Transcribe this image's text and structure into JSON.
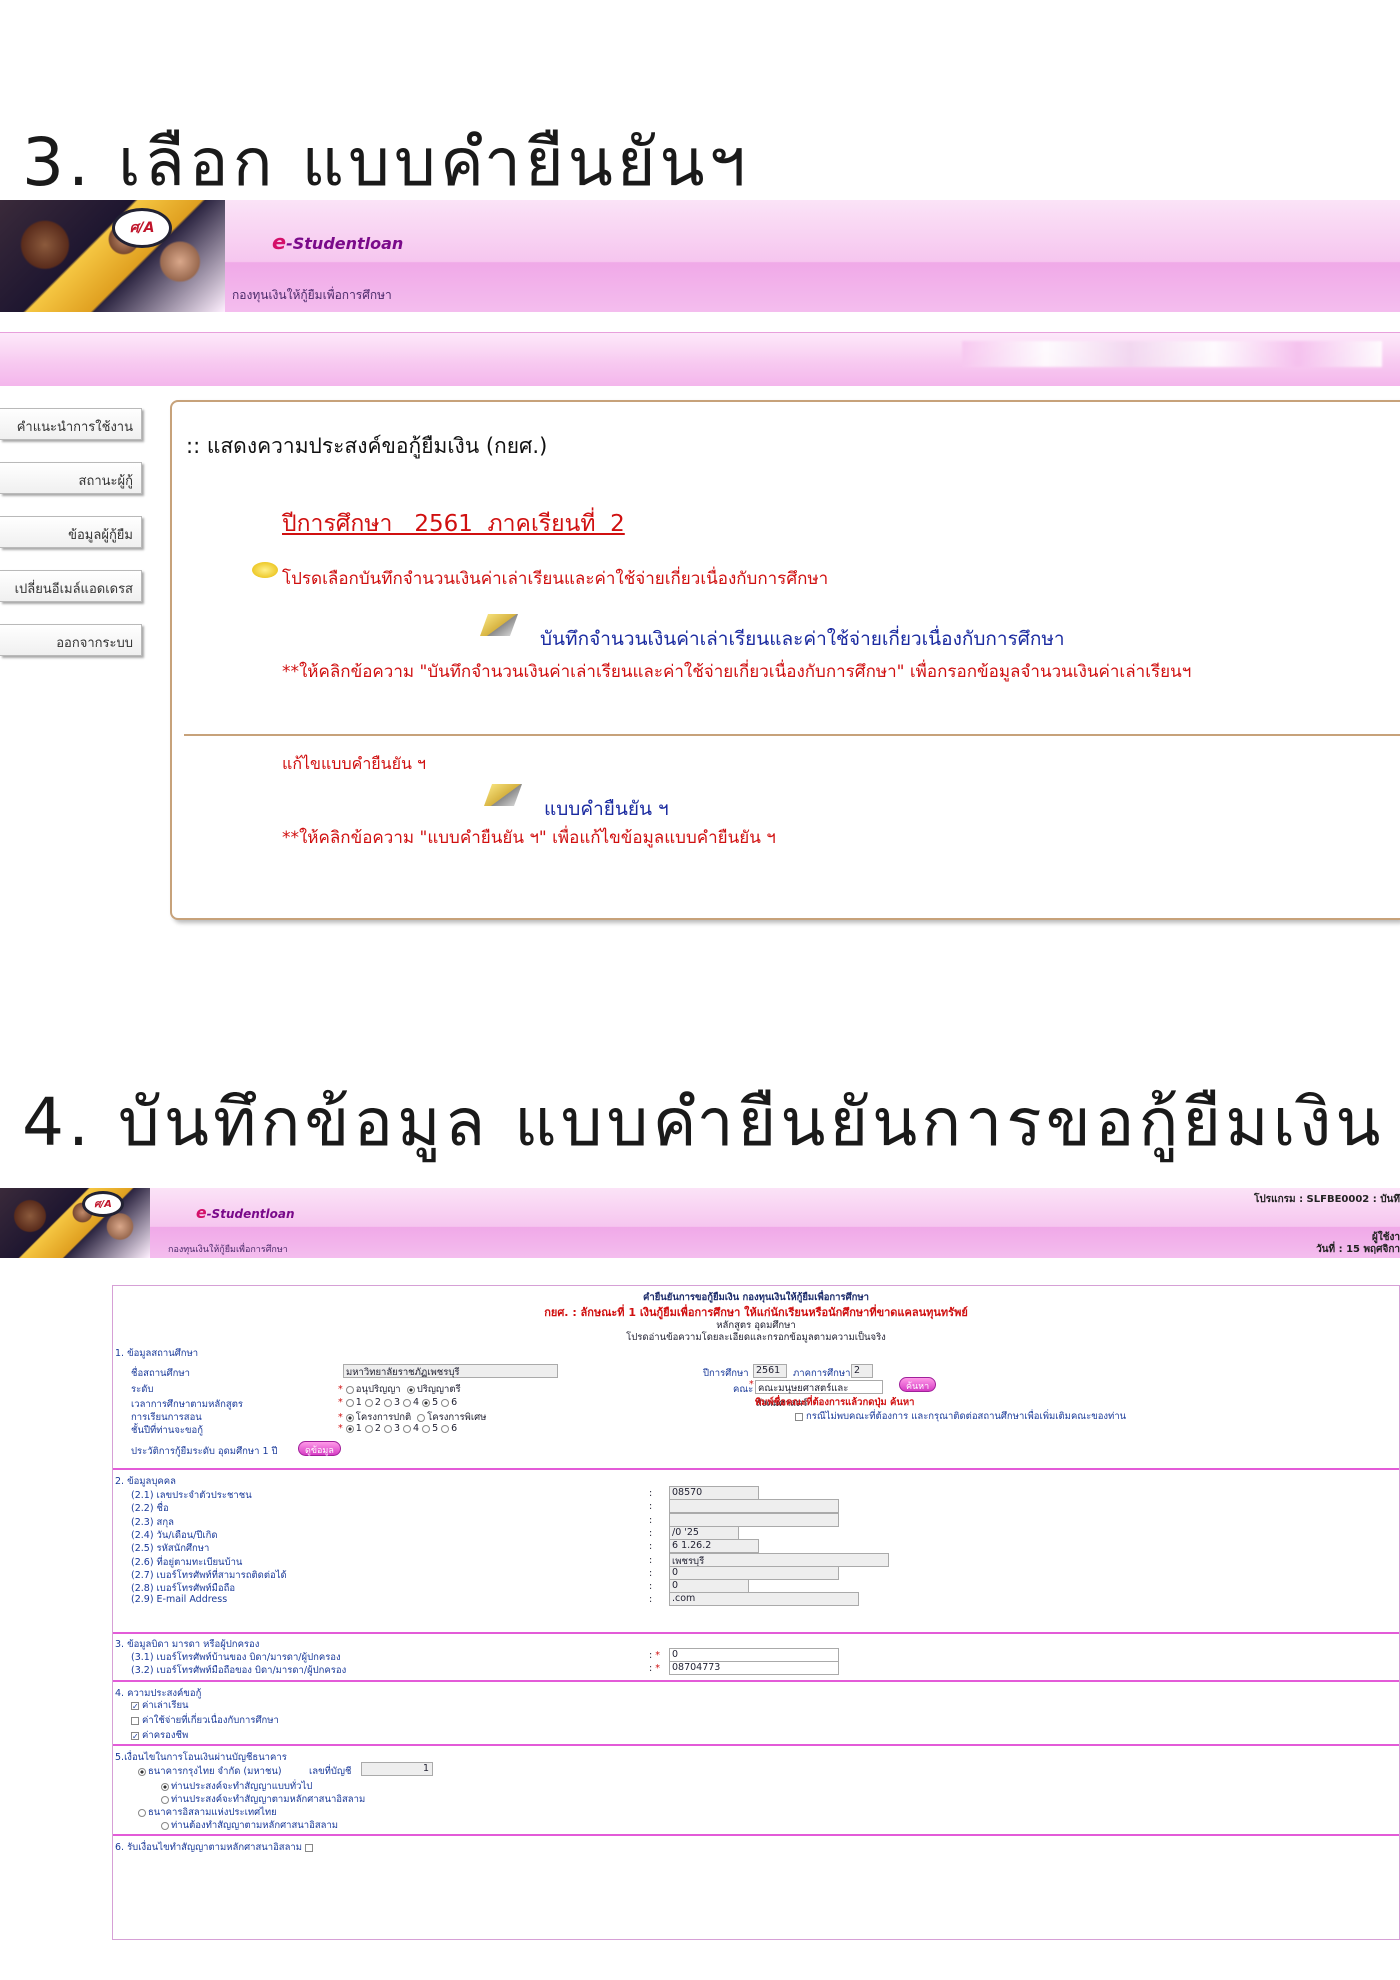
{
  "step3": {
    "title": "3. เลือก แบบคำยืนยันฯ"
  },
  "step4": {
    "title": "4. บันทึกข้อมูล แบบคำยืนยันการขอกู้ยืมเงิน"
  },
  "banner": {
    "logo_text": "ศ/A",
    "brand_prefix": "e",
    "brand_name": "-Studentloan",
    "subtitle": "กองทุนเงินให้กู้ยืมเพื่อการศึกษา"
  },
  "sidebar": {
    "items": [
      {
        "label": "คำแนะนำการใช้งาน"
      },
      {
        "label": "สถานะผู้กู้"
      },
      {
        "label": "ข้อมูลผู้กู้ยืม"
      },
      {
        "label": "เปลี่ยนอีเมล์แอดเดรส"
      },
      {
        "label": "ออกจากระบบ"
      }
    ]
  },
  "panel": {
    "heading": ":: แสดงความประสงค์ขอกู้ยืมเงิน (กยศ.)",
    "year_line": "ปีการศึกษา   2561  ภาคเรียนที่  2",
    "select_note": "โปรดเลือกบันทึกจำนวนเงินค่าเล่าเรียนและค่าใช้จ่ายเกี่ยวเนื่องกับการศึกษา",
    "record_link": "บันทึกจำนวนเงินค่าเล่าเรียนและค่าใช้จ่ายเกี่ยวเนื่องกับการศึกษา",
    "record_hint": "**ให้คลิกข้อความ \"บันทึกจำนวนเงินค่าเล่าเรียนและค่าใช้จ่ายเกี่ยวเนื่องกับการศึกษา\" เพื่อกรอกข้อมูลจำนวนเงินค่าเล่าเรียนฯ",
    "edit_heading": "แก้ไขแบบคำยืนยัน ฯ",
    "confirm_link": "แบบคำยืนยัน ฯ",
    "confirm_hint": "**ให้คลิกข้อความ \"แบบคำยืนยัน ฯ\" เพื่อแก้ไขข้อมูลแบบคำยืนยัน ฯ"
  },
  "header4": {
    "program": "โปรแกรม  : SLFBE0002  : บันทึ",
    "user": "ผู้ใช้งา",
    "date": "วันที่  : 15 พฤศจิกา"
  },
  "form": {
    "title": "คำยืนยันการขอกู้ยืมเงิน กองทุนเงินให้กู้ยืมเพื่อการศึกษา",
    "subtitle": "กยศ. : ลักษณะที่ 1 เงินกู้ยืมเพื่อการศึกษา ให้แก่นักเรียนหรือนักศึกษาที่ขาดแคลนทุนทรัพย์",
    "course": "หลักสูตร อุดมศึกษา",
    "instruction": "โปรดอ่านข้อความโดยละเอียดและกรอกข้อมูลตามความเป็นจริง",
    "s1": {
      "title": "1. ข้อมูลสถานศึกษา",
      "school_label": "ชื่อสถานศึกษา",
      "school_value": "มหาวิทยาลัยราชภัฏเพชรบุรี",
      "level_label": "ระดับ",
      "level_opt1": "อนุปริญญา",
      "level_opt2": "ปริญญาตรี",
      "duration_label": "เวลาการศึกษาตามหลักสูตร",
      "program_type_label": "การเรียนการสอน",
      "program_opt1": "โครงการปกติ",
      "program_opt2": "โครงการพิเศษ",
      "year_level_label": "ชั้นปีที่ท่านจะขอกู้",
      "history": "ประวัติการกู้ยืมระดับ อุดมศึกษา    1   ปี",
      "history_btn": "ดูข้อมูล",
      "acad_year_label": "ปีการศึกษา",
      "acad_year_value": "2561",
      "term_label": "ภาคการศึกษา",
      "term_value": "2",
      "faculty_label": "คณะ",
      "faculty_value": "คณะมนุษยศาสตร์และสังคมศาสตร์",
      "search_btn": "ค้นหา",
      "faculty_hint": "พิมพ์ชื่อคณะที่ต้องการแล้วกดปุ่ม ค้นหา",
      "faculty_missing": "กรณีไม่พบคณะที่ต้องการ และกรุณาติดต่อสถานศึกษาเพื่อเพิ่มเติมคณะของท่าน",
      "nums": [
        "1",
        "2",
        "3",
        "4",
        "5",
        "6"
      ]
    },
    "s2": {
      "title": "2. ข้อมูลบุคคล",
      "rows": [
        {
          "label": "(2.1) เลขประจำตัวประชาชน",
          "value": "08570"
        },
        {
          "label": "(2.2) ชื่อ",
          "value": ""
        },
        {
          "label": "(2.3) สกุล",
          "value": ""
        },
        {
          "label": "(2.4) วัน/เดือน/ปีเกิด",
          "value": "/0  '25"
        },
        {
          "label": "(2.5) รหัสนักศึกษา",
          "value": "6  1.26.2"
        },
        {
          "label": "(2.6) ที่อยู่ตามทะเบียนบ้าน",
          "value": "เพชรบุรี"
        },
        {
          "label": "(2.7) เบอร์โทรศัพท์ที่สามารถติดต่อได้",
          "value": "0"
        },
        {
          "label": "(2.8) เบอร์โทรศัพท์มือถือ",
          "value": "0"
        },
        {
          "label": "(2.9) E-mail Address",
          "value": ".com"
        }
      ]
    },
    "s3": {
      "title": "3. ข้อมูลบิดา มารดา หรือผู้ปกครอง",
      "row1": "(3.1) เบอร์โทรศัพท์บ้านของ บิดา/มารดา/ผู้ปกครอง",
      "row2": "(3.2) เบอร์โทรศัพท์มือถือของ บิดา/มารดา/ผู้ปกครอง",
      "val1": "0",
      "val2": "08704773"
    },
    "s4": {
      "title": "4. ความประสงค์ขอกู้",
      "opt1": "ค่าเล่าเรียน",
      "opt2": "ค่าใช้จ่ายที่เกี่ยวเนื่องกับการศึกษา",
      "opt3": "ค่าครองชีพ"
    },
    "s5": {
      "title": "5.เงื่อนไขในการโอนเงินผ่านบัญชีธนาคาร",
      "bank1": "ธนาคารกรุงไทย จำกัด (มหาชน)",
      "acct_label": "เลขที่บัญชี",
      "acct_value": "1",
      "sub1": "ท่านประสงค์จะทำสัญญาแบบทั่วไป",
      "sub2": "ท่านประสงค์จะทำสัญญาตามหลักศาสนาอิสลาม",
      "bank2": "ธนาคารอิสลามแห่งประเทศไทย",
      "sub3": "ท่านต้องทำสัญญาตามหลักศาสนาอิสลาม"
    },
    "s6": {
      "title": "6. รับเงื่อนไขทำสัญญาตามหลักศาสนาอิสลาม"
    }
  }
}
